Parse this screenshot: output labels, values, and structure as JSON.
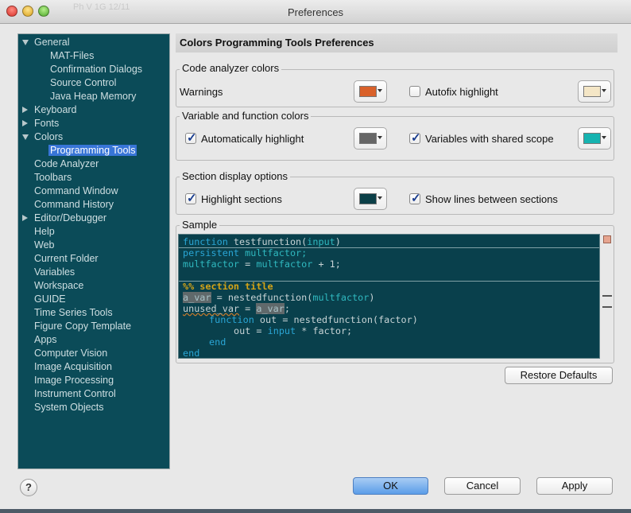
{
  "window": {
    "title": "Preferences",
    "ghost_text": "Ph V 1G 12/11"
  },
  "tree": {
    "items": [
      {
        "label": "General",
        "level": 0,
        "expander": "down"
      },
      {
        "label": "MAT-Files",
        "level": 1
      },
      {
        "label": "Confirmation Dialogs",
        "level": 1
      },
      {
        "label": "Source Control",
        "level": 1
      },
      {
        "label": "Java Heap Memory",
        "level": 1
      },
      {
        "label": "Keyboard",
        "level": 0,
        "expander": "right"
      },
      {
        "label": "Fonts",
        "level": 0,
        "expander": "right"
      },
      {
        "label": "Colors",
        "level": 0,
        "expander": "down"
      },
      {
        "label": "Programming Tools",
        "level": 1,
        "selected": true
      },
      {
        "label": "Code Analyzer",
        "level": 0
      },
      {
        "label": "Toolbars",
        "level": 0
      },
      {
        "label": "Command Window",
        "level": 0
      },
      {
        "label": "Command History",
        "level": 0
      },
      {
        "label": "Editor/Debugger",
        "level": 0,
        "expander": "right"
      },
      {
        "label": "Help",
        "level": 0
      },
      {
        "label": "Web",
        "level": 0
      },
      {
        "label": "Current Folder",
        "level": 0
      },
      {
        "label": "Variables",
        "level": 0
      },
      {
        "label": "Workspace",
        "level": 0
      },
      {
        "label": "GUIDE",
        "level": 0
      },
      {
        "label": "Time Series Tools",
        "level": 0
      },
      {
        "label": "Figure Copy Template",
        "level": 0
      },
      {
        "label": "Apps",
        "level": 0
      },
      {
        "label": "Computer Vision",
        "level": 0
      },
      {
        "label": "Image Acquisition",
        "level": 0
      },
      {
        "label": "Image Processing",
        "level": 0
      },
      {
        "label": "Instrument Control",
        "level": 0
      },
      {
        "label": "System Objects",
        "level": 0
      }
    ]
  },
  "panel": {
    "title": "Colors Programming Tools Preferences",
    "code_analyzer": {
      "title": "Code analyzer colors",
      "warnings_label": "Warnings",
      "warnings_color": "#d9612a",
      "autofix_label": "Autofix highlight",
      "autofix_checked": false,
      "autofix_color": "#f4e6c6"
    },
    "variables": {
      "title": "Variable and function colors",
      "auto_highlight_label": "Automatically highlight",
      "auto_highlight_checked": true,
      "auto_highlight_color": "#666666",
      "shared_scope_label": "Variables with shared scope",
      "shared_scope_checked": true,
      "shared_scope_color": "#16b3b0"
    },
    "sections": {
      "title": "Section display options",
      "highlight_label": "Highlight sections",
      "highlight_checked": true,
      "highlight_color": "#0b3f47",
      "lines_label": "Show lines between sections",
      "lines_checked": true
    },
    "sample": {
      "title": "Sample",
      "line1": {
        "kw": "function",
        "name": " testfunction(",
        "arg": "input",
        "close": ")"
      },
      "line2": {
        "kw": "persistent",
        "rest": " multfactor;"
      },
      "line3": {
        "v1": "multfactor",
        "mid": " = ",
        "v2": "multfactor",
        "end": " + 1;"
      },
      "line4": {
        "text": "%% section title"
      },
      "line5": {
        "hl": "a_var",
        "mid": " = nestedfunction(",
        "v": "multfactor",
        "end": ")"
      },
      "line6": {
        "unused": "unused_var",
        "mid": " = ",
        "hl": "a_var",
        "end": ";"
      },
      "line7": {
        "kw": "function",
        "rest": " out = nestedfunction(factor)"
      },
      "line8": {
        "pre": "out = ",
        "v": "input",
        "rest": " * factor;"
      },
      "line9": {
        "kw": "end"
      },
      "line10": {
        "kw": "end"
      }
    },
    "restore_defaults_label": "Restore Defaults"
  },
  "buttons": {
    "help": "?",
    "ok": "OK",
    "cancel": "Cancel",
    "apply": "Apply"
  }
}
